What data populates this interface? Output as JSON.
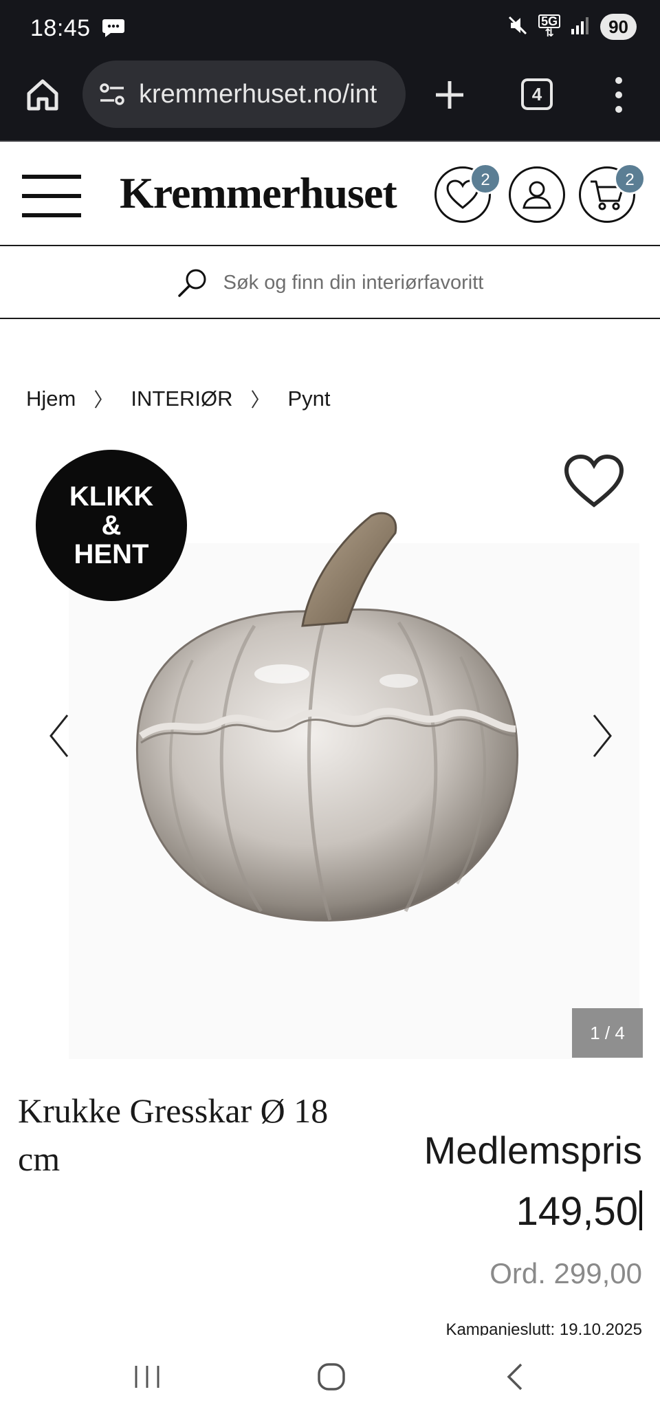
{
  "status_bar": {
    "time": "18:45",
    "network": "5G",
    "battery": "90"
  },
  "browser": {
    "url": "kremmerhuset.no/int",
    "tab_count": "4"
  },
  "header": {
    "logo": "Kremmerhuset",
    "wishlist_count": "2",
    "cart_count": "2"
  },
  "search": {
    "placeholder": "Søk og finn din interiørfavoritt"
  },
  "breadcrumb": {
    "items": [
      "Hjem",
      "INTERIØR",
      "Pynt"
    ],
    "separator": "〉"
  },
  "gallery": {
    "badge_line1": "KLIKK",
    "badge_line2": "&",
    "badge_line3": "HENT",
    "counter": "1 / 4"
  },
  "product": {
    "title": "Krukke Gresskar Ø 18 cm",
    "price_label": "Medlemspris",
    "price": "149,50",
    "ord_price": "Ord. 299,00",
    "campaign": "Kampanjeslutt: 19.10.2025"
  },
  "colors": {
    "status_bg": "#15161b",
    "badge_blue": "#5b7e94",
    "counter_bg": "#8f8f8f"
  }
}
